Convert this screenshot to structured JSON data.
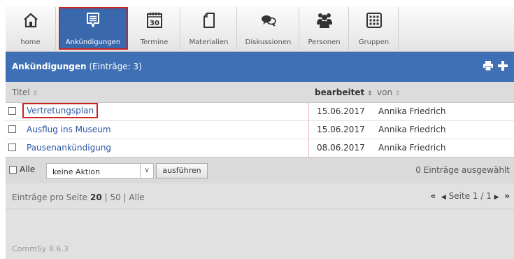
{
  "nav": {
    "items": [
      {
        "label": "home",
        "icon": "home-icon"
      },
      {
        "label": "Ankündigungen",
        "icon": "announcement-icon",
        "active": true
      },
      {
        "label": "Termine",
        "icon": "calendar-icon",
        "day": "30"
      },
      {
        "label": "Materialien",
        "icon": "document-icon"
      },
      {
        "label": "Diskussionen",
        "icon": "discussion-icon"
      },
      {
        "label": "Personen",
        "icon": "people-icon"
      },
      {
        "label": "Gruppen",
        "icon": "groups-icon"
      }
    ]
  },
  "section": {
    "title": "Ankündigungen",
    "count_text": "(Einträge: 3)"
  },
  "columns": {
    "title": "Titel",
    "edited": "bearbeitet",
    "by": "von"
  },
  "rows": [
    {
      "title": "Vertretungsplan",
      "date": "15.06.2017",
      "author": "Annika Friedrich",
      "highlighted": true
    },
    {
      "title": "Ausflug ins Museum",
      "date": "15.06.2017",
      "author": "Annika Friedrich"
    },
    {
      "title": "Pausenankündigung",
      "date": "08.06.2017",
      "author": "Annika Friedrich"
    }
  ],
  "actions": {
    "select_all_label": "Alle",
    "action_select_value": "keine Aktion",
    "execute_label": "ausführen",
    "selected_text": "0 Einträge ausgewählt"
  },
  "pagination": {
    "per_page_prefix": "Einträge pro Seite",
    "per_page_current": "20",
    "per_page_sep1": "|",
    "per_page_option2": "50",
    "per_page_sep2": "|",
    "per_page_option3": "Alle",
    "first_symbol": "«",
    "prev_symbol": "◀",
    "page_text": "Seite 1 / 1",
    "next_symbol": "▶",
    "last_symbol": "»"
  },
  "footer": {
    "version": "CommSy 8.6.3"
  },
  "colors": {
    "header_blue": "#3f6fb4",
    "active_tab": "#3a68ad",
    "highlight_red": "#cc2222",
    "link_blue": "#2a55a0"
  }
}
